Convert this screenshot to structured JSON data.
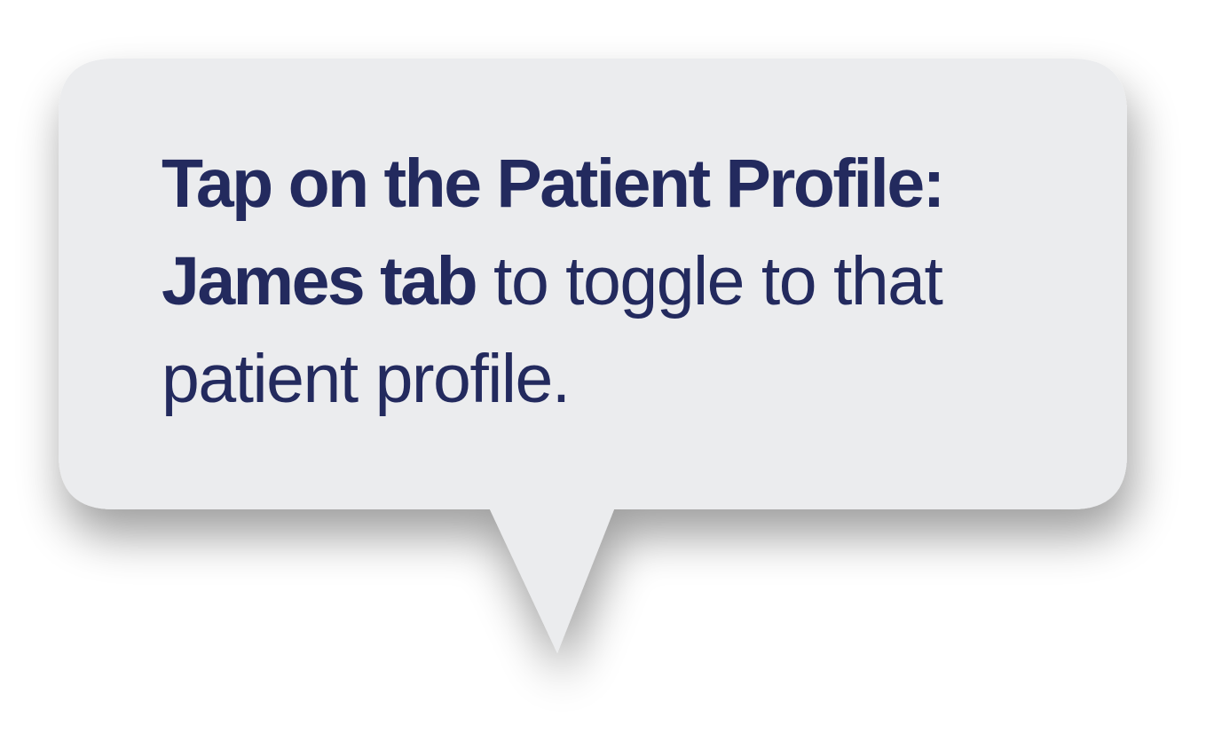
{
  "tooltip": {
    "bold_text": "Tap on the Patient Profile: James tab",
    "regular_text": " to toggle to that patient profile."
  },
  "colors": {
    "bubble_fill": "#ebecee",
    "text": "#232a5e"
  }
}
